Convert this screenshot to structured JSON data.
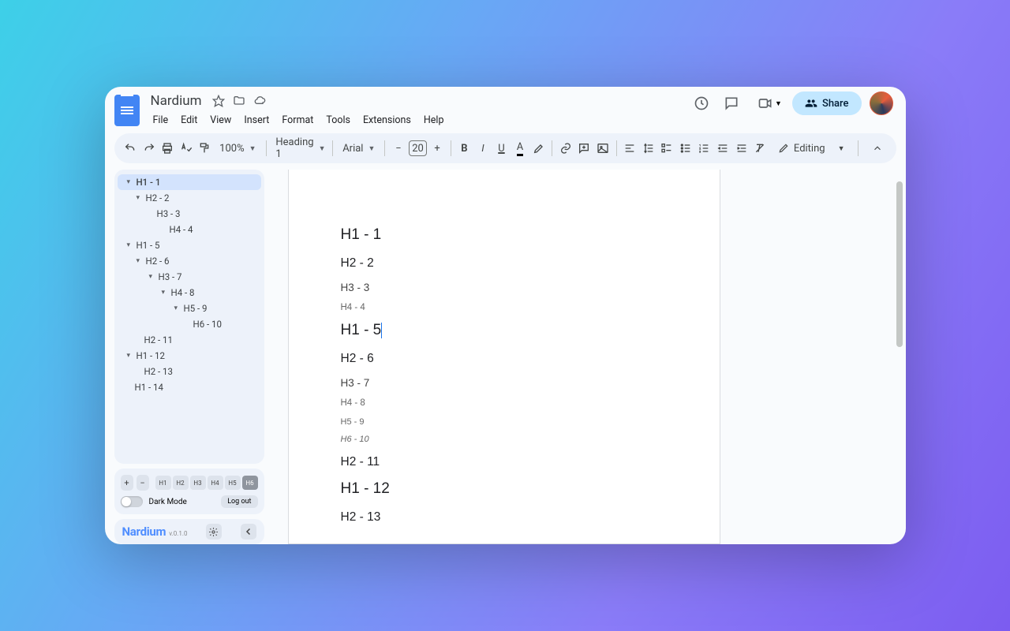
{
  "doc_title": "Nardium",
  "menus": [
    "File",
    "Edit",
    "View",
    "Insert",
    "Format",
    "Tools",
    "Extensions",
    "Help"
  ],
  "share_label": "Share",
  "toolbar": {
    "zoom": "100%",
    "style": "Heading 1",
    "font": "Arial",
    "font_size": "20",
    "mode": "Editing"
  },
  "outline": [
    {
      "label": "H1 - 1",
      "level": 1,
      "collapsible": true,
      "active": true
    },
    {
      "label": "H2 - 2",
      "level": 2,
      "collapsible": true
    },
    {
      "label": "H3 - 3",
      "level": 3,
      "collapsible": false
    },
    {
      "label": "H4 - 4",
      "level": 4,
      "collapsible": false
    },
    {
      "label": "H1 - 5",
      "level": 1,
      "collapsible": true
    },
    {
      "label": "H2 - 6",
      "level": 2,
      "collapsible": true
    },
    {
      "label": "H3 - 7",
      "level": 3,
      "collapsible": true
    },
    {
      "label": "H4 - 8",
      "level": 4,
      "collapsible": true
    },
    {
      "label": "H5 - 9",
      "level": 5,
      "collapsible": true
    },
    {
      "label": "H6 - 10",
      "level": 6,
      "collapsible": false
    },
    {
      "label": "H2 - 11",
      "level": 2,
      "collapsible": false
    },
    {
      "label": "H1 - 12",
      "level": 1,
      "collapsible": true
    },
    {
      "label": "H2 - 13",
      "level": 2,
      "collapsible": false
    },
    {
      "label": "H1 - 14",
      "level": 1,
      "collapsible": false
    }
  ],
  "heading_buttons": [
    "H1",
    "H2",
    "H3",
    "H4",
    "H5",
    "H6"
  ],
  "active_heading_button": 5,
  "dark_mode_label": "Dark Mode",
  "logout_label": "Log out",
  "ext_name": "Nardium",
  "ext_version": "v.0.1.0",
  "page_content": [
    {
      "cls": "h1",
      "text": "H1 - 1"
    },
    {
      "cls": "h2",
      "text": "H2 - 2"
    },
    {
      "cls": "h3",
      "text": "H3 - 3"
    },
    {
      "cls": "h4",
      "text": "H4 - 4"
    },
    {
      "cls": "h1",
      "text": "H1 - 5",
      "cursor": true
    },
    {
      "cls": "h2",
      "text": "H2 - 6"
    },
    {
      "cls": "h3",
      "text": "H3 - 7"
    },
    {
      "cls": "h4",
      "text": "H4 - 8"
    },
    {
      "cls": "h5",
      "text": "H5 - 9"
    },
    {
      "cls": "h6",
      "text": "H6 - 10"
    },
    {
      "cls": "h2",
      "text": "H2 - 11"
    },
    {
      "cls": "h1",
      "text": "H1 - 12"
    },
    {
      "cls": "h2",
      "text": "H2 - 13"
    }
  ]
}
